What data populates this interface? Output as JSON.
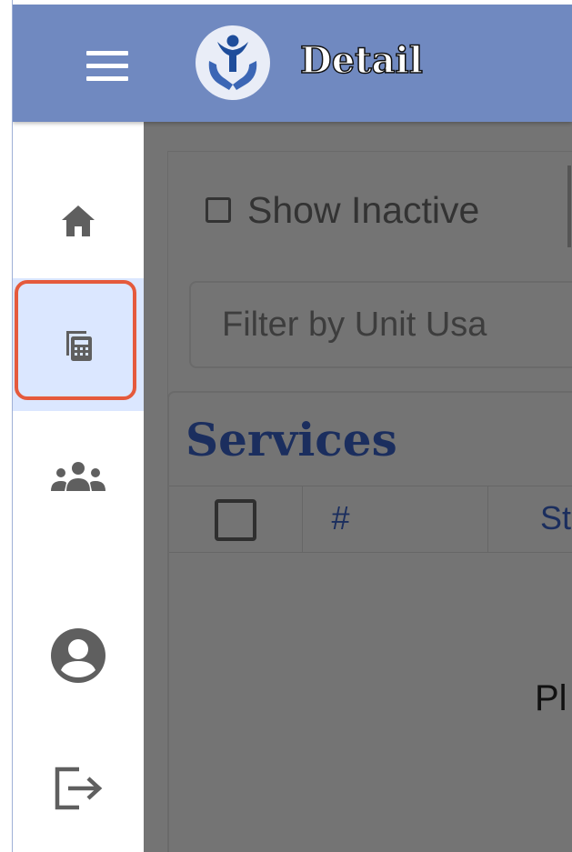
{
  "header": {
    "title": "Detail",
    "menu_icon": "hamburger-menu-icon",
    "logo": "hands-holding-person-logo",
    "bar_color": "#7089c0"
  },
  "sidebar": {
    "items": [
      {
        "icon": "home-icon",
        "selected": false
      },
      {
        "icon": "calculator-icon",
        "selected": true
      },
      {
        "icon": "group-icon",
        "selected": false
      },
      {
        "icon": "account-circle-icon",
        "selected": false
      },
      {
        "icon": "logout-icon",
        "selected": false
      }
    ],
    "selected_bg": "#dbe7ff",
    "highlight_color": "#e55a3c"
  },
  "filters": {
    "show_inactive_label": "Show Inactive",
    "show_inactive_checked": false,
    "unit_usage_placeholder": "Filter by Unit Usa"
  },
  "services": {
    "title": "Services",
    "columns": [
      "#",
      "Sta"
    ],
    "body_text": "Pl"
  }
}
